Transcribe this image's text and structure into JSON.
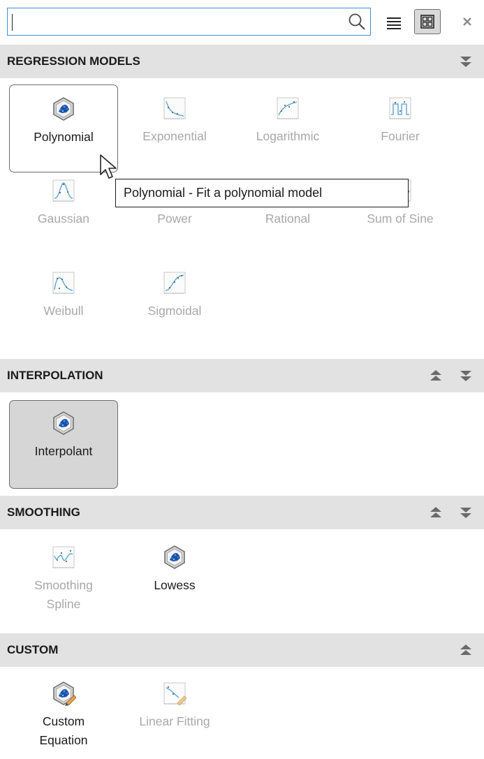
{
  "search": {
    "value": "",
    "placeholder": ""
  },
  "toolbar": {
    "search_icon": "search-icon",
    "list_view_icon": "list-view-icon",
    "grid_view_icon": "grid-view-icon",
    "close_icon": "close-icon",
    "grid_view_active": true
  },
  "sections": {
    "regression": {
      "title": "REGRESSION MODELS",
      "items": [
        {
          "label": "Polynomial",
          "enabled": true,
          "state": "hovered",
          "icon": "polynomial-icon"
        },
        {
          "label": "Exponential",
          "enabled": false,
          "icon": "exponential-icon"
        },
        {
          "label": "Logarithmic",
          "enabled": false,
          "icon": "logarithmic-icon"
        },
        {
          "label": "Fourier",
          "enabled": false,
          "icon": "fourier-icon"
        },
        {
          "label": "Gaussian",
          "enabled": false,
          "icon": "gaussian-icon"
        },
        {
          "label": "Power",
          "enabled": false,
          "icon": "power-icon"
        },
        {
          "label": "Rational",
          "enabled": false,
          "icon": "rational-icon"
        },
        {
          "label": "Sum of Sine",
          "enabled": false,
          "icon": "sum-of-sine-icon"
        },
        {
          "label": "Weibull",
          "enabled": false,
          "icon": "weibull-icon"
        },
        {
          "label": "Sigmoidal",
          "enabled": false,
          "icon": "sigmoidal-icon"
        }
      ]
    },
    "interpolation": {
      "title": "INTERPOLATION",
      "items": [
        {
          "label": "Interpolant",
          "enabled": true,
          "state": "selected",
          "icon": "interpolant-icon"
        }
      ]
    },
    "smoothing": {
      "title": "SMOOTHING",
      "items": [
        {
          "label_line1": "Smoothing",
          "label_line2": "Spline",
          "enabled": false,
          "icon": "smoothing-spline-icon"
        },
        {
          "label": "Lowess",
          "enabled": true,
          "icon": "lowess-icon"
        }
      ]
    },
    "custom": {
      "title": "CUSTOM",
      "items": [
        {
          "label_line1": "Custom",
          "label_line2": "Equation",
          "enabled": true,
          "icon": "custom-equation-icon"
        },
        {
          "label": "Linear Fitting",
          "enabled": false,
          "icon": "linear-fitting-icon"
        }
      ]
    }
  },
  "tooltip": {
    "text": "Polynomial - Fit a polynomial model"
  },
  "colors": {
    "header_bg": "#e2e2e2",
    "disabled_text": "#a8a8a8",
    "search_border": "#3d8fd6",
    "selected_bg": "#d6d6d6",
    "curve_blue": "#4aa3d8"
  }
}
